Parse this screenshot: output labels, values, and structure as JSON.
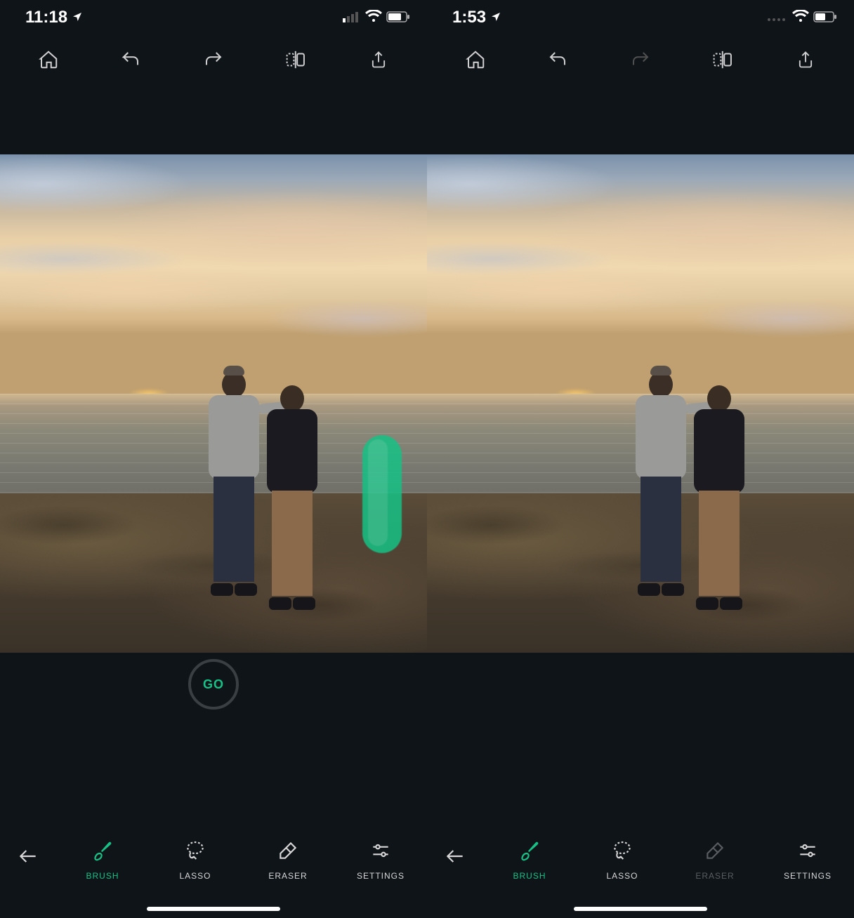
{
  "accent": "#16c286",
  "panes": [
    {
      "status": {
        "time": "11:18",
        "cellular_bars": 1,
        "wifi": true,
        "battery_pct": 70
      },
      "top_toolbar": {
        "home": "home",
        "undo": "undo",
        "redo": "redo",
        "compare": "compare",
        "share": "share",
        "redo_enabled": true
      },
      "canvas": {
        "brush_mark_visible": true
      },
      "go": {
        "label": "GO",
        "visible": true
      },
      "bottom": {
        "back": "back",
        "tools": [
          {
            "id": "brush",
            "label": "BRUSH",
            "active": true,
            "enabled": true
          },
          {
            "id": "lasso",
            "label": "LASSO",
            "active": false,
            "enabled": true
          },
          {
            "id": "eraser",
            "label": "ERASER",
            "active": false,
            "enabled": true
          },
          {
            "id": "settings",
            "label": "SETTINGS",
            "active": false,
            "enabled": true
          }
        ]
      }
    },
    {
      "status": {
        "time": "1:53",
        "cellular_bars": 0,
        "wifi": true,
        "battery_pct": 55
      },
      "top_toolbar": {
        "home": "home",
        "undo": "undo",
        "redo": "redo",
        "compare": "compare",
        "share": "share",
        "redo_enabled": false
      },
      "canvas": {
        "brush_mark_visible": false
      },
      "go": {
        "label": "GO",
        "visible": false
      },
      "bottom": {
        "back": "back",
        "tools": [
          {
            "id": "brush",
            "label": "BRUSH",
            "active": true,
            "enabled": true
          },
          {
            "id": "lasso",
            "label": "LASSO",
            "active": false,
            "enabled": true
          },
          {
            "id": "eraser",
            "label": "ERASER",
            "active": false,
            "enabled": false
          },
          {
            "id": "settings",
            "label": "SETTINGS",
            "active": false,
            "enabled": true
          }
        ]
      }
    }
  ]
}
